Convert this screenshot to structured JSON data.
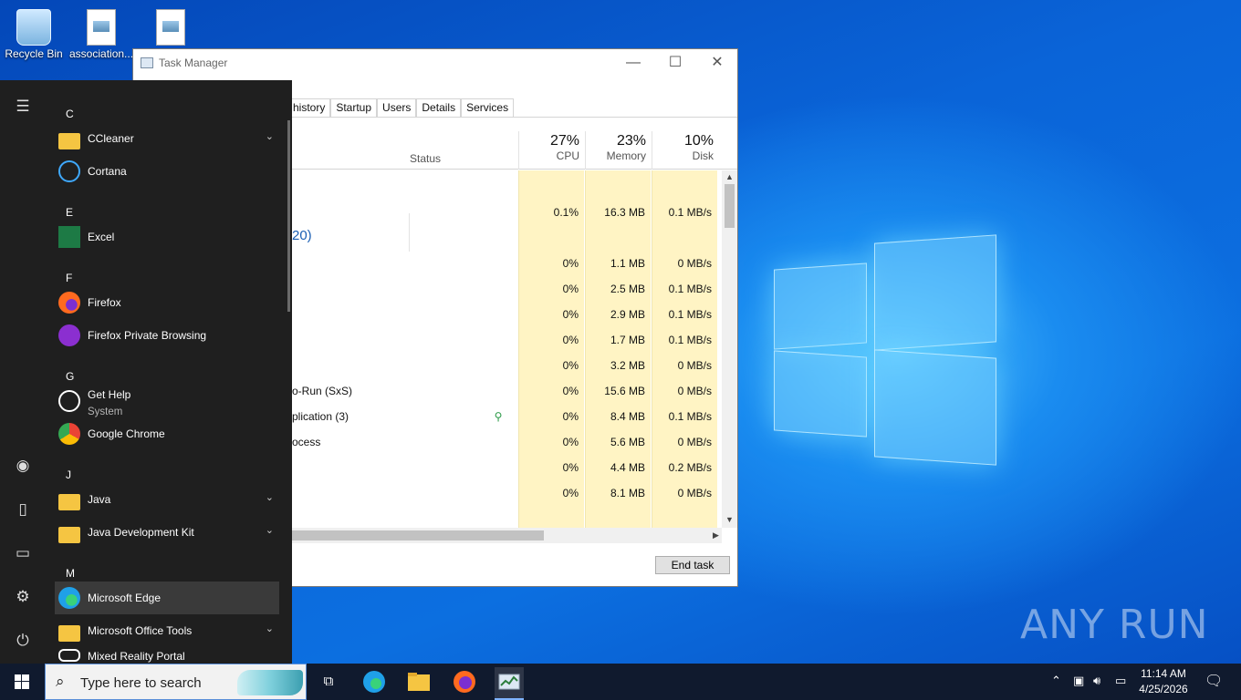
{
  "desktop": {
    "icons": [
      {
        "label": "Recycle Bin"
      },
      {
        "label": "association..."
      },
      {
        "label": ""
      }
    ],
    "watermark": "ANY RUN"
  },
  "task_manager": {
    "title": "Task Manager",
    "window_buttons": {
      "minimize": "—",
      "maximize": "☐",
      "close": "✕"
    },
    "tabs": [
      "history",
      "Startup",
      "Users",
      "Details",
      "Services"
    ],
    "columns": {
      "status": "Status",
      "cpu": {
        "pct": "27%",
        "label": "CPU"
      },
      "memory": {
        "pct": "23%",
        "label": "Memory"
      },
      "disk": {
        "pct": "10%",
        "label": "Disk"
      }
    },
    "rows": [
      {
        "name": "",
        "status": "",
        "cpu": "",
        "memory": "",
        "disk": ""
      },
      {
        "name": "",
        "status": "",
        "cpu": "0.1%",
        "memory": "16.3 MB",
        "disk": "0.1 MB/s"
      },
      {
        "name": "20)",
        "status": "",
        "cpu": "",
        "memory": "",
        "disk": ""
      },
      {
        "name": "",
        "status": "",
        "cpu": "0%",
        "memory": "1.1 MB",
        "disk": "0 MB/s"
      },
      {
        "name": "",
        "status": "",
        "cpu": "0%",
        "memory": "2.5 MB",
        "disk": "0.1 MB/s"
      },
      {
        "name": "",
        "status": "",
        "cpu": "0%",
        "memory": "2.9 MB",
        "disk": "0.1 MB/s"
      },
      {
        "name": "",
        "status": "",
        "cpu": "0%",
        "memory": "1.7 MB",
        "disk": "0.1 MB/s"
      },
      {
        "name": "",
        "status": "",
        "cpu": "0%",
        "memory": "3.2 MB",
        "disk": "0 MB/s"
      },
      {
        "name": "o-Run (SxS)",
        "status": "",
        "cpu": "0%",
        "memory": "15.6 MB",
        "disk": "0 MB/s"
      },
      {
        "name": "plication (3)",
        "status": "leaf-icon",
        "cpu": "0%",
        "memory": "8.4 MB",
        "disk": "0.1 MB/s"
      },
      {
        "name": "ocess",
        "status": "",
        "cpu": "0%",
        "memory": "5.6 MB",
        "disk": "0 MB/s"
      },
      {
        "name": "",
        "status": "",
        "cpu": "0%",
        "memory": "4.4 MB",
        "disk": "0.2 MB/s"
      },
      {
        "name": "",
        "status": "",
        "cpu": "0%",
        "memory": "8.1 MB",
        "disk": "0 MB/s"
      }
    ],
    "end_task": "End task"
  },
  "start_menu": {
    "sections": [
      {
        "letter": "C",
        "apps": [
          {
            "label": "CCleaner",
            "icon": "folder-icon",
            "expand": true
          },
          {
            "label": "Cortana",
            "icon": "cortana-icon"
          }
        ]
      },
      {
        "letter": "E",
        "apps": [
          {
            "label": "Excel",
            "icon": "excel-icon"
          }
        ]
      },
      {
        "letter": "F",
        "apps": [
          {
            "label": "Firefox",
            "icon": "firefox-icon"
          },
          {
            "label": "Firefox Private Browsing",
            "icon": "firefox-private-icon"
          }
        ]
      },
      {
        "letter": "G",
        "apps": [
          {
            "label": "Get Help",
            "sub": "System",
            "icon": "get-help-icon"
          },
          {
            "label": "Google Chrome",
            "icon": "chrome-icon"
          }
        ]
      },
      {
        "letter": "J",
        "apps": [
          {
            "label": "Java",
            "icon": "folder-icon",
            "expand": true
          },
          {
            "label": "Java Development Kit",
            "icon": "folder-icon",
            "expand": true
          }
        ]
      },
      {
        "letter": "M",
        "apps": [
          {
            "label": "Microsoft Edge",
            "icon": "edge-icon",
            "selected": true
          },
          {
            "label": "Microsoft Office Tools",
            "icon": "folder-icon",
            "expand": true
          },
          {
            "label": "Mixed Reality Portal",
            "icon": "mixed-reality-icon"
          }
        ]
      }
    ]
  },
  "taskbar": {
    "search_placeholder": "Type here to search",
    "clock_time": "11:14 AM",
    "clock_date": "4/25/2026"
  }
}
